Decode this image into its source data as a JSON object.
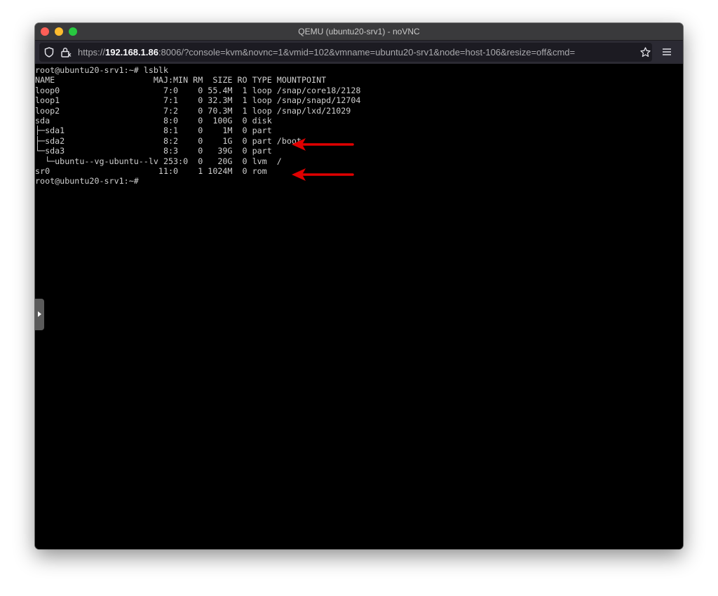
{
  "window": {
    "title": "QEMU (ubuntu20-srv1) - noVNC"
  },
  "browser": {
    "url_prefix": "https://",
    "url_host": "192.168.1.86",
    "url_rest": ":8006/?console=kvm&novnc=1&vmid=102&vmname=ubuntu20-srv1&node=host-106&resize=off&cmd=",
    "icons": [
      "shield-icon",
      "lock-icon",
      "star-icon",
      "hamburger-menu-icon"
    ]
  },
  "terminal": {
    "lines": [
      "root@ubuntu20-srv1:~# lsblk",
      "NAME                    MAJ:MIN RM  SIZE RO TYPE MOUNTPOINT",
      "loop0                     7:0    0 55.4M  1 loop /snap/core18/2128",
      "loop1                     7:1    0 32.3M  1 loop /snap/snapd/12704",
      "loop2                     7:2    0 70.3M  1 loop /snap/lxd/21029",
      "sda                       8:0    0  100G  0 disk",
      "├─sda1                    8:1    0    1M  0 part",
      "├─sda2                    8:2    0    1G  0 part /boot",
      "└─sda3                    8:3    0   39G  0 part",
      "  └─ubuntu--vg-ubuntu--lv 253:0  0   20G  0 lvm  /",
      "sr0                      11:0    1 1024M  0 rom",
      "root@ubuntu20-srv1:~#"
    ]
  },
  "annotations": {
    "arrow_color": "#e00000"
  }
}
